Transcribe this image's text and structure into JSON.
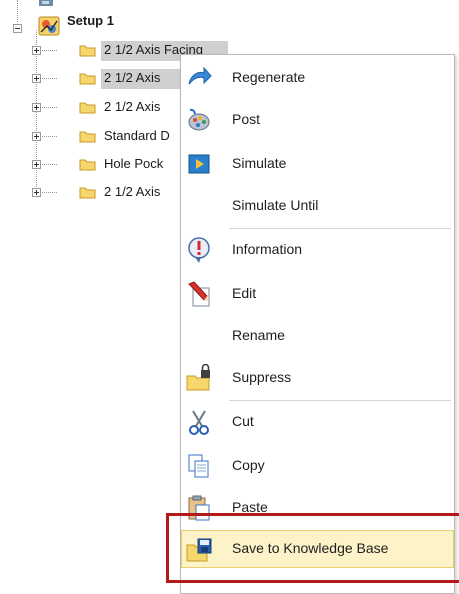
{
  "tree": {
    "setup_label": "Setup 1",
    "children": [
      {
        "label": "2 1/2 Axis Facing"
      },
      {
        "label": "2 1/2 Axis"
      },
      {
        "label": "2 1/2 Axis"
      },
      {
        "label": "Standard D"
      },
      {
        "label": "Hole Pock"
      },
      {
        "label": "2 1/2 Axis"
      }
    ]
  },
  "menu": {
    "items": [
      {
        "label": "Regenerate",
        "icon": "regenerate-icon"
      },
      {
        "label": "Post",
        "icon": "post-icon"
      },
      {
        "label": "Simulate",
        "icon": "simulate-icon"
      },
      {
        "label": "Simulate Until",
        "icon": ""
      },
      {
        "label": "Information",
        "icon": "information-icon"
      },
      {
        "label": "Edit",
        "icon": "edit-icon"
      },
      {
        "label": "Rename",
        "icon": ""
      },
      {
        "label": "Suppress",
        "icon": "suppress-icon"
      },
      {
        "label": "Cut",
        "icon": "cut-icon"
      },
      {
        "label": "Copy",
        "icon": "copy-icon"
      },
      {
        "label": "Paste",
        "icon": "paste-icon"
      },
      {
        "label": "Save to Knowledge Base",
        "icon": "save-to-knowledge-base-icon"
      }
    ],
    "highlighted_item": "Save to Knowledge Base"
  },
  "colors": {
    "highlight_fill": "#fdf3c8",
    "highlight_border": "#e9cf6f",
    "callout": "#b31b1b",
    "selected_row": "#cfcfcf"
  }
}
